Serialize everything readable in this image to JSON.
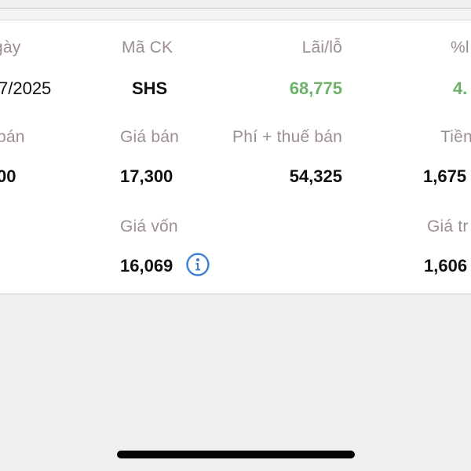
{
  "row1": {
    "labels": {
      "date": "gày",
      "symbol": "Mã CK",
      "profit_loss": "Lãi/lỗ",
      "percent": "%l"
    },
    "values": {
      "date": "7/2025",
      "symbol": "SHS",
      "profit_loss": "68,775",
      "percent": "4."
    }
  },
  "row2": {
    "labels": {
      "sell_volume": "bán",
      "sell_price": "Giá bán",
      "sell_fee_tax": "Phí + thuế bán",
      "amount": "Tiền"
    },
    "values": {
      "sell_volume": "00",
      "sell_price": "17,300",
      "sell_fee_tax": "54,325",
      "amount": "1,675"
    }
  },
  "row3": {
    "labels": {
      "cost_price": "Giá vốn",
      "value": "Giá tr"
    },
    "values": {
      "cost_price": "16,069",
      "value": "1,606"
    }
  },
  "colors": {
    "label": "#9c8f8f",
    "value": "#111111",
    "profit": "#6fb36a",
    "info_icon": "#3d7fd6",
    "background": "#efeff1",
    "card": "#ffffff"
  },
  "icons": {
    "cost_info": "info-icon"
  }
}
